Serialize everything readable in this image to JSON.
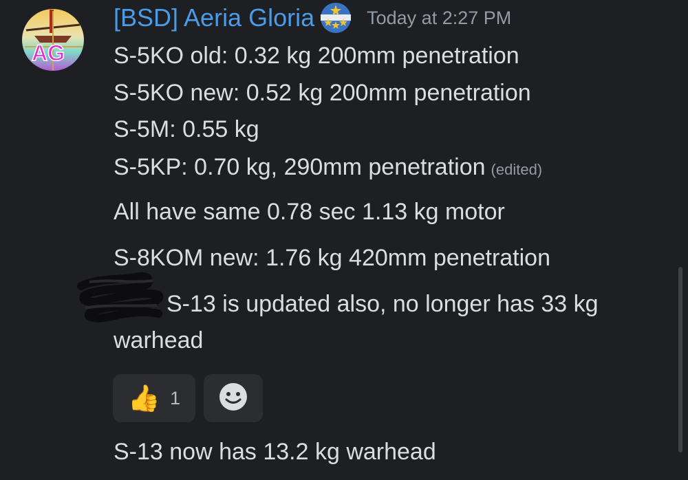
{
  "message": {
    "author": "[BSD] Aeria Gloria",
    "avatar_letters": "AG",
    "server_badge": "stars-badge-icon",
    "timestamp": "Today at 2:27 PM",
    "lines": [
      "S-5KO old: 0.32 kg 200mm penetration",
      "S-5KO new: 0.52 kg 200mm penetration",
      "S-5M: 0.55 kg",
      "S-5KP: 0.70 kg, 290mm penetration"
    ],
    "edited_tag": "(edited)",
    "followups": [
      "All have same 0.78 sec 1.13 kg motor",
      "S-8KOM new: 1.76 kg 420mm penetration"
    ],
    "reply_preview": "S-13 is updated also, no longer has 33 kg",
    "reply_preview_cont": "warhead",
    "reactions": [
      {
        "emoji": "👍",
        "icon": "thumbs-up-icon",
        "count": "1"
      }
    ],
    "add_reaction_icon": "smiley-icon",
    "final_line": "S-13 now has 13.2 kg warhead"
  },
  "colors": {
    "background": "#1e1f22",
    "username": "#4a9be8",
    "text": "#dbdee1",
    "muted": "#949ba4",
    "reaction_bg": "#2b2d31"
  }
}
